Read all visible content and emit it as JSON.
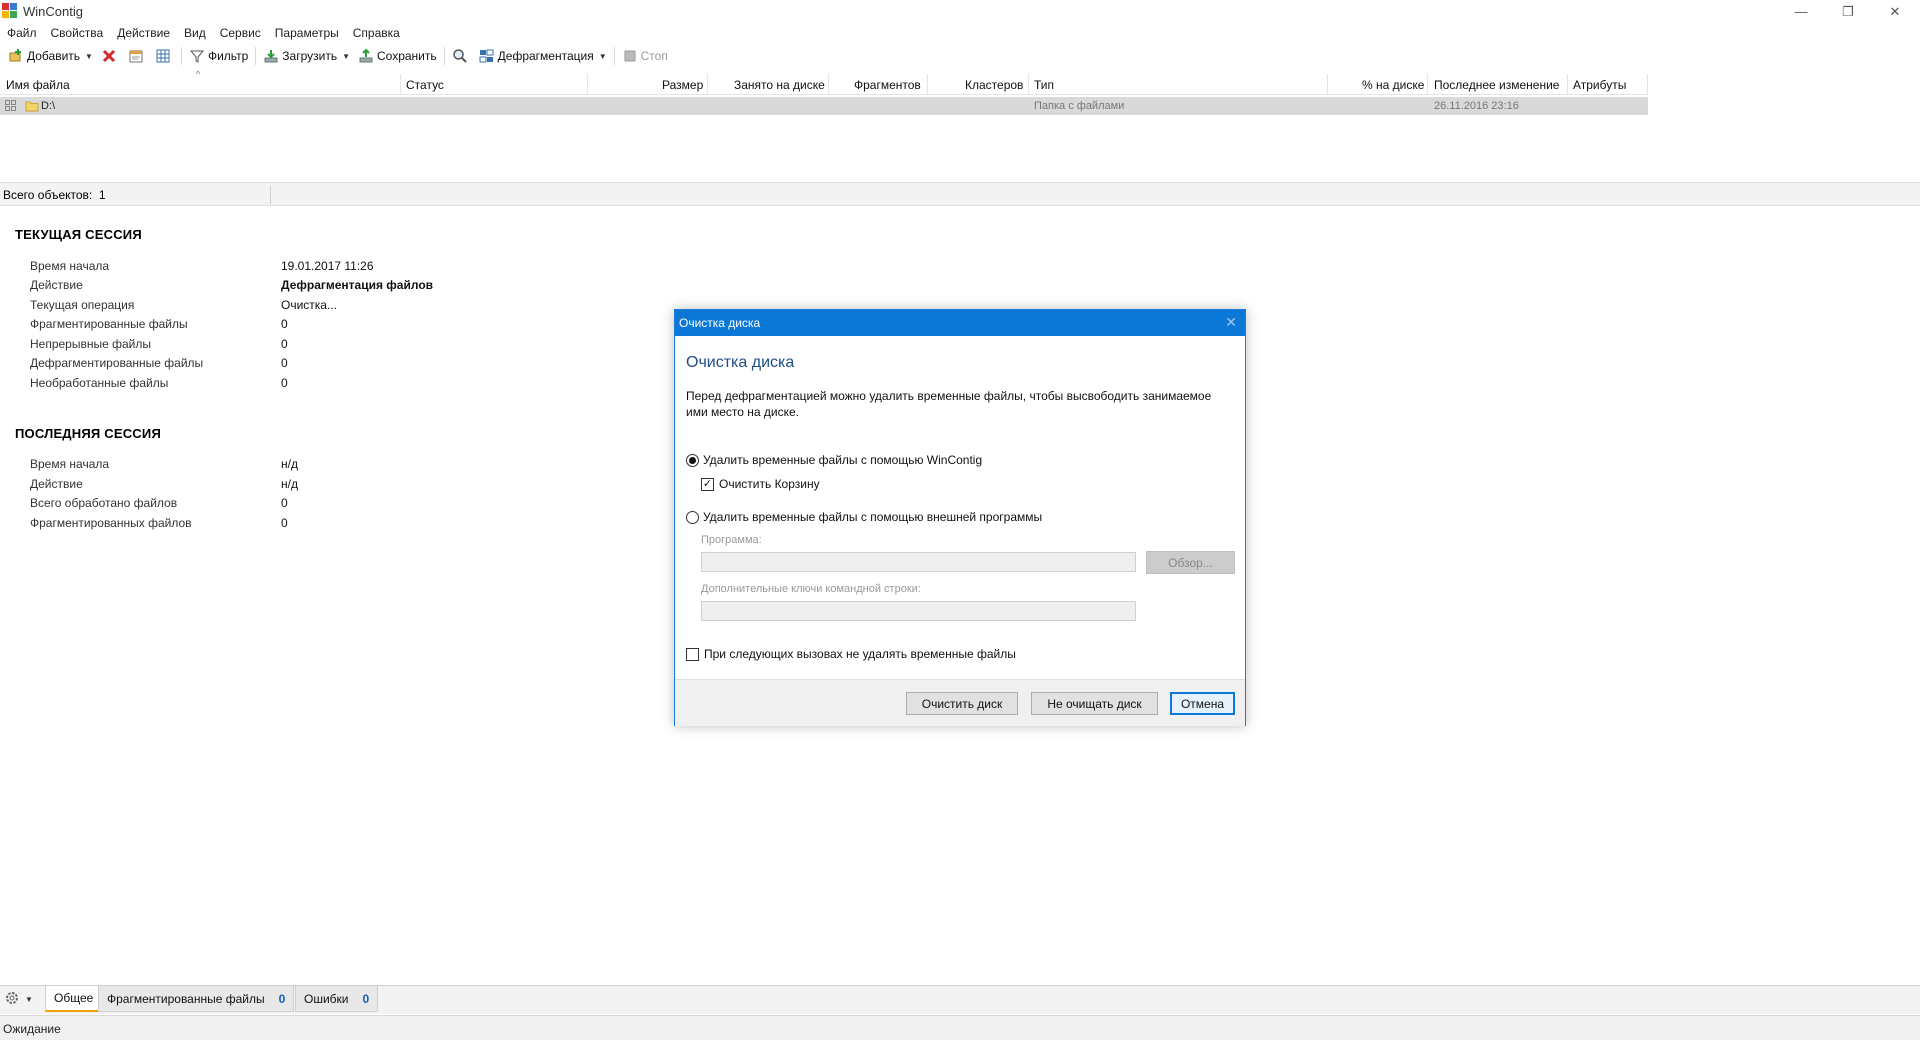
{
  "window": {
    "title": "WinContig",
    "minimize_glyph": "—",
    "restore_glyph": "❐",
    "close_glyph": "✕"
  },
  "menu": [
    "Файл",
    "Свойства",
    "Действие",
    "Вид",
    "Сервис",
    "Параметры",
    "Справка"
  ],
  "toolbar": {
    "add_label": "Добавить",
    "filter_label": "Фильтр",
    "load_label": "Загрузить",
    "save_label": "Сохранить",
    "defrag_label": "Дефрагментация",
    "stop_label": "Стоп"
  },
  "file_list": {
    "columns": [
      "Имя файла",
      "Статус",
      "Размер",
      "Занято на диске",
      "Фрагментов",
      "Кластеров",
      "Тип",
      "% на диске",
      "Последнее изменение",
      "Атрибуты"
    ],
    "rows": [
      {
        "name": "D:\\",
        "type": "Папка с файлами",
        "modified": "26.11.2016 23:16"
      }
    ],
    "total_label": "Всего объектов:",
    "total_value": "1"
  },
  "current_session": {
    "title": "ТЕКУЩАЯ СЕССИЯ",
    "rows": [
      {
        "label": "Время начала",
        "value": "19.01.2017 11:26"
      },
      {
        "label": "Действие",
        "value": "Дефрагментация файлов"
      },
      {
        "label": "Текущая операция",
        "value": "Очистка..."
      },
      {
        "label": "Фрагментированные файлы",
        "value": "0"
      },
      {
        "label": "Непрерывные файлы",
        "value": "0"
      },
      {
        "label": "Дефрагментированные файлы",
        "value": "0"
      },
      {
        "label": "Необработанные файлы",
        "value": "0"
      }
    ]
  },
  "last_session": {
    "title": "ПОСЛЕДНЯЯ СЕССИЯ",
    "rows": [
      {
        "label": "Время начала",
        "value": "н/д"
      },
      {
        "label": "Действие",
        "value": "н/д"
      },
      {
        "label": "Всего обработано файлов",
        "value": "0"
      },
      {
        "label": "Фрагментированных файлов",
        "value": "0"
      }
    ]
  },
  "dialog": {
    "title": "Очистка диска",
    "heading": "Очистка диска",
    "description": "Перед дефрагментацией можно удалить временные файлы, чтобы высвободить занимаемое ими место на диске.",
    "option_wincontig": "Удалить временные файлы с помощью WinContig",
    "option_recycle": "Очистить Корзину",
    "option_external": "Удалить временные файлы с помощью внешней программы",
    "program_label": "Программа:",
    "program_value": "",
    "browse_label": "Обзор...",
    "args_label": "Дополнительные ключи командной строки:",
    "args_value": "",
    "dont_delete_label": "При следующих вызовах не удалять временные файлы",
    "clean_button": "Очистить диск",
    "no_clean_button": "Не очищать диск",
    "cancel_button": "Отмена"
  },
  "tabs": {
    "general": "Общее",
    "fragmented": "Фрагментированные файлы",
    "fragmented_count": "0",
    "errors": "Ошибки",
    "errors_count": "0"
  },
  "status": "Ожидание"
}
